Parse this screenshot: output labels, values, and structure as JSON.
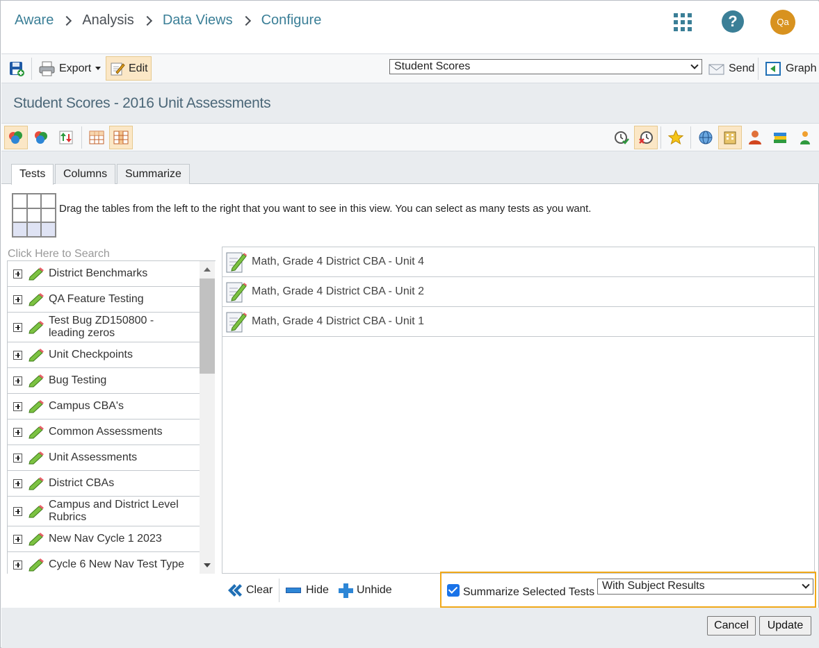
{
  "breadcrumb": {
    "items": [
      "Aware",
      "Analysis",
      "Data Views",
      "Configure"
    ]
  },
  "header_icons": {
    "apps": "grid-apps-icon",
    "help": "?",
    "avatar_initials": "Qa",
    "accent": "#3b7f97",
    "avatar_color": "#d8921f"
  },
  "toolbar": {
    "export_label": "Export",
    "edit_label": "Edit",
    "view_select": "Student Scores",
    "send_label": "Send",
    "graph_label": "Graph"
  },
  "page_title": "Student Scores - 2016 Unit Assessments",
  "tabs": {
    "tests": "Tests",
    "columns": "Columns",
    "summarize": "Summarize",
    "selected": "Tests"
  },
  "instructions": "Drag the tables from the left to the right that you want to see in this view. You can select as many tests as you want.",
  "search": {
    "placeholder": "Click Here to Search"
  },
  "available_tests": [
    "District Benchmarks",
    "QA Feature Testing",
    "Test Bug ZD150800 - leading zeros",
    "Unit Checkpoints",
    "Bug Testing",
    "Campus CBA's",
    "Common Assessments",
    "Unit Assessments",
    "District CBAs",
    "Campus and District Level Rubrics",
    "New Nav Cycle 1 2023",
    "Cycle 6 New Nav Test Type"
  ],
  "selected_tests": [
    "Math, Grade 4 District CBA - Unit 4",
    "Math, Grade 4 District CBA - Unit 2",
    "Math, Grade 4 District CBA - Unit 1"
  ],
  "list_actions": {
    "clear": "Clear",
    "hide": "Hide",
    "unhide": "Unhide"
  },
  "summarize": {
    "checkbox_label": "Summarize Selected Tests",
    "checked": true,
    "option": "With Subject Results",
    "highlight_color": "#f0a818"
  },
  "footer": {
    "cancel": "Cancel",
    "update": "Update"
  }
}
